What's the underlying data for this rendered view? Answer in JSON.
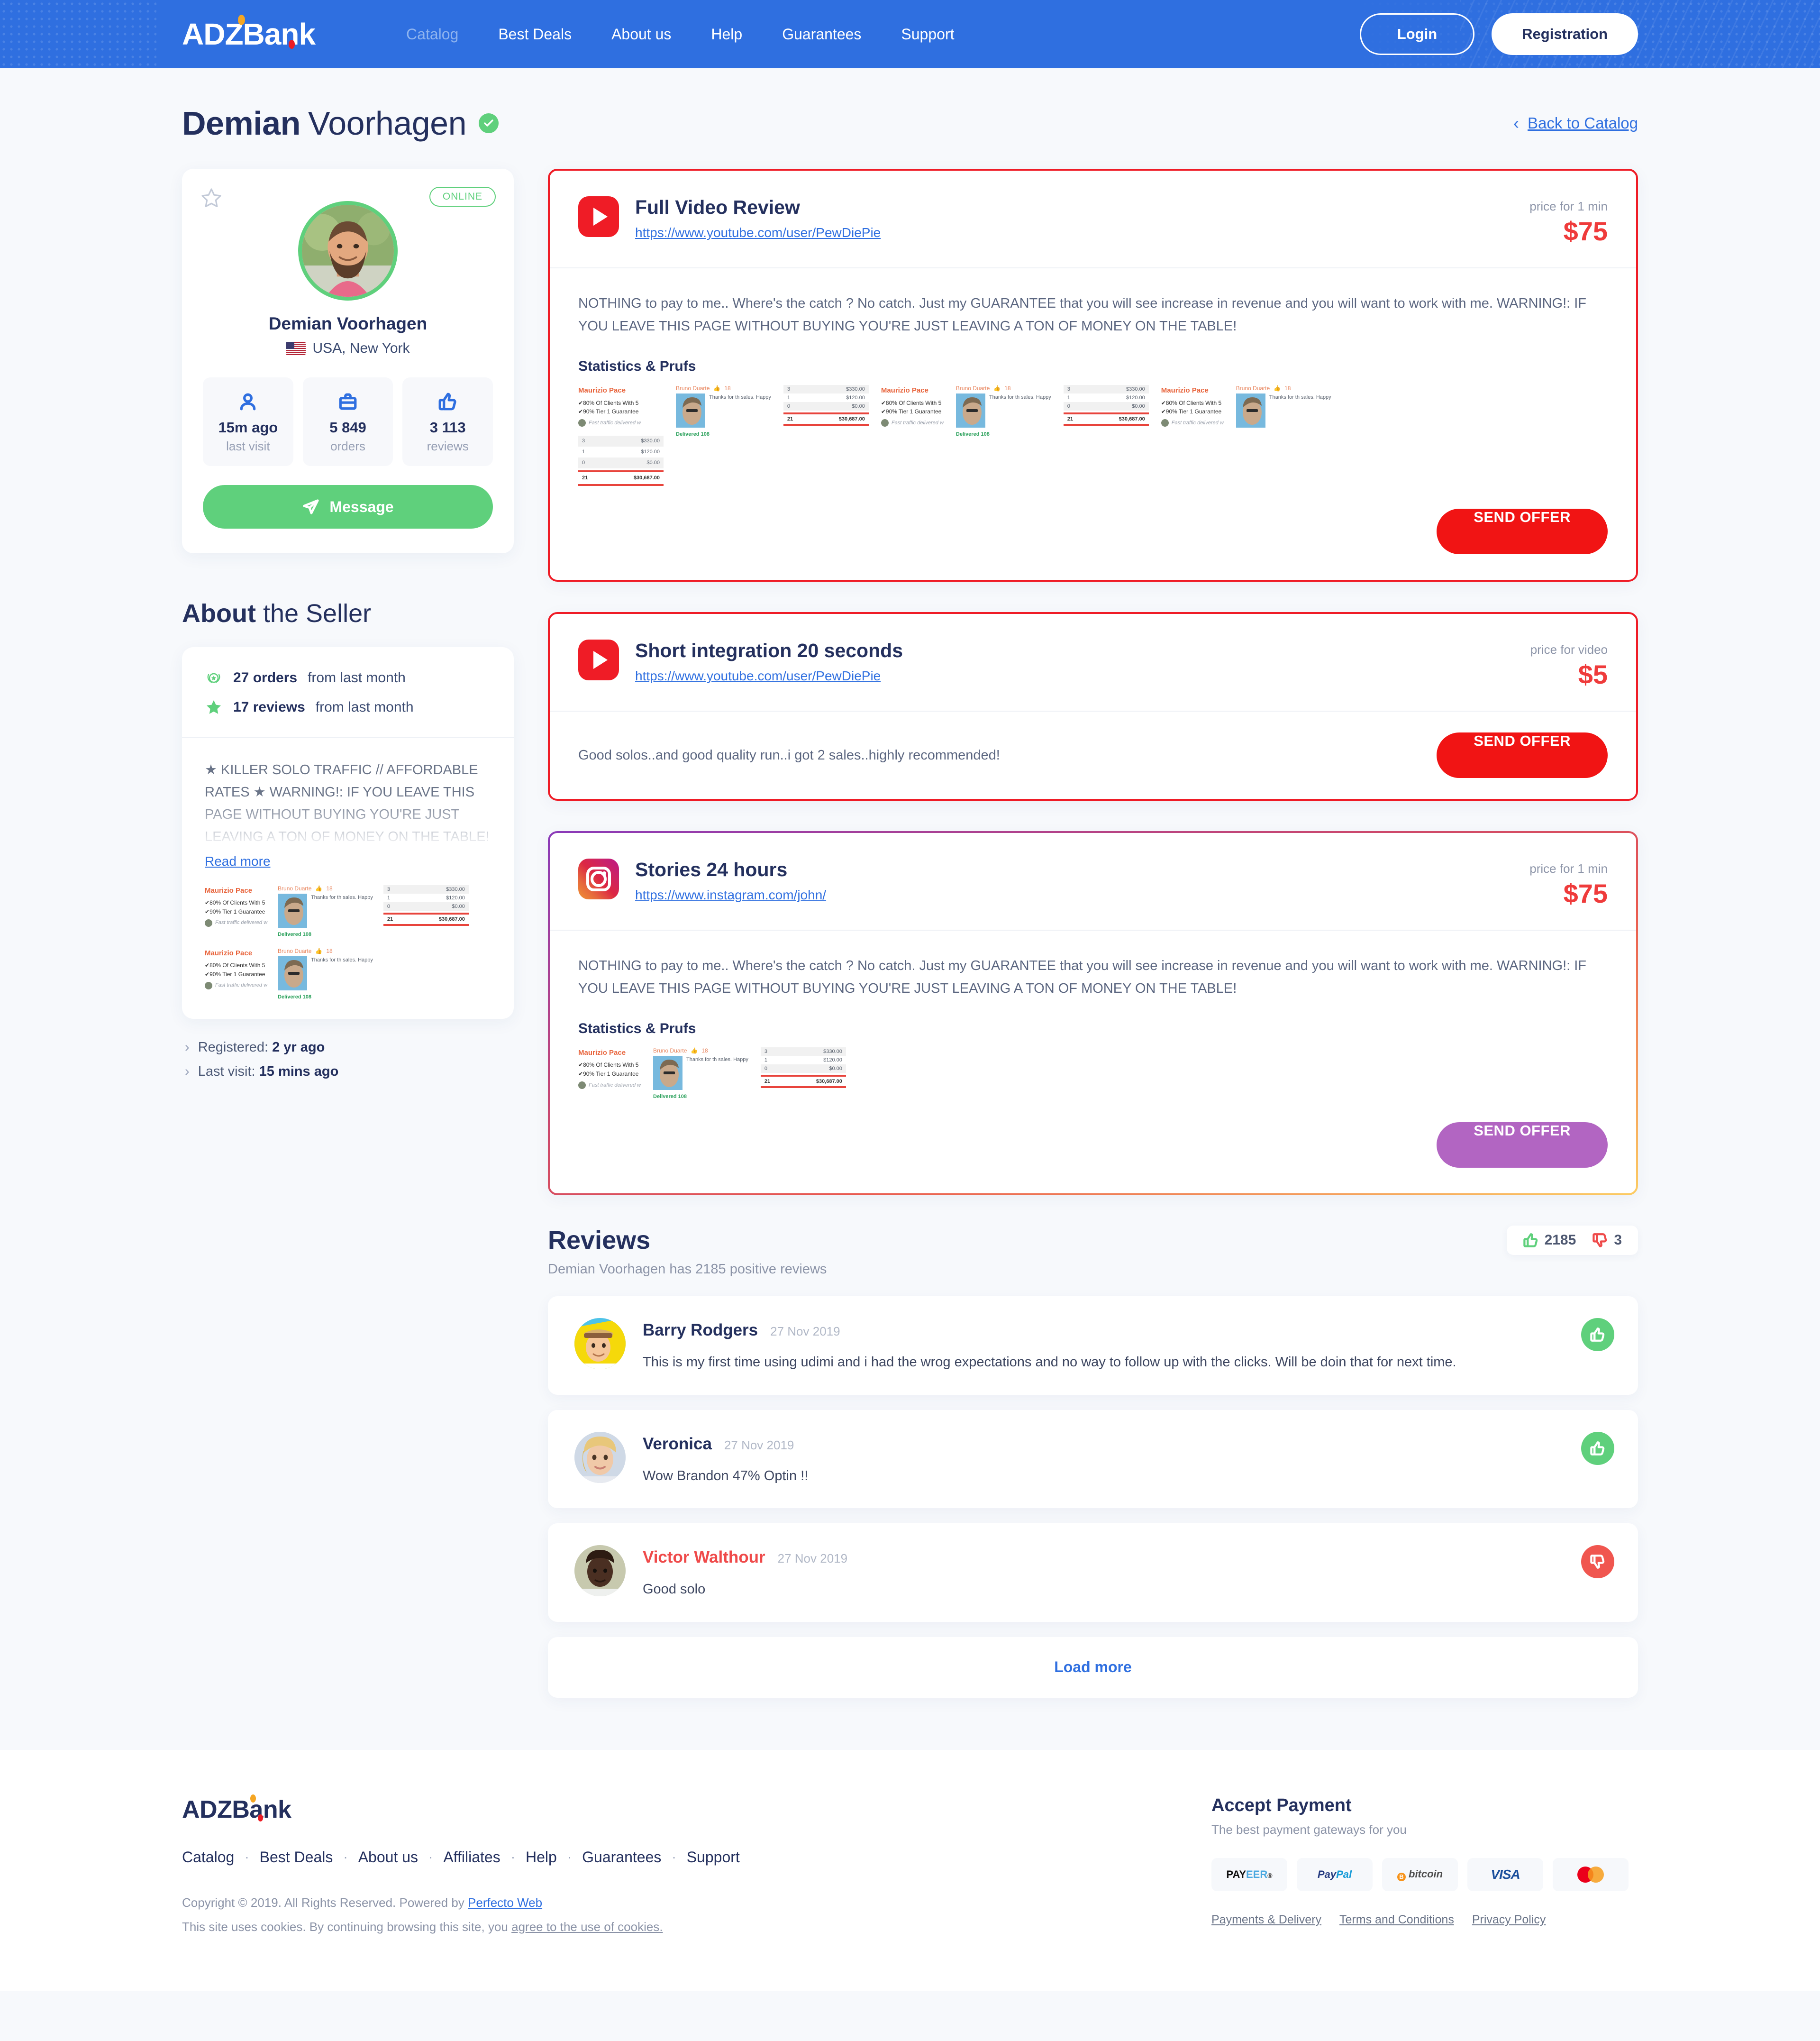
{
  "header": {
    "logo": "ADZBank",
    "nav": [
      {
        "label": "Catalog",
        "active": true
      },
      {
        "label": "Best Deals",
        "active": false
      },
      {
        "label": "About us",
        "active": false
      },
      {
        "label": "Help",
        "active": false
      },
      {
        "label": "Guarantees",
        "active": false
      },
      {
        "label": "Support",
        "active": false
      }
    ],
    "login_label": "Login",
    "registration_label": "Registration"
  },
  "page": {
    "title_bold": "Demian",
    "title_light": "Voorhagen",
    "back_link": "Back to Catalog"
  },
  "profile": {
    "status": "ONLINE",
    "name": "Demian Voorhagen",
    "location": "USA, New York",
    "stats": [
      {
        "icon": "user-icon",
        "value": "15m ago",
        "label": "last visit"
      },
      {
        "icon": "briefcase-icon",
        "value": "5 849",
        "label": "orders"
      },
      {
        "icon": "thumbs-up-icon",
        "value": "3 113",
        "label": "reviews"
      }
    ],
    "message_label": "Message"
  },
  "about": {
    "heading_bold": "About",
    "heading_light": "the Seller",
    "facts": [
      {
        "icon": "laurel-icon",
        "bold": "27 orders",
        "rest": "from last month"
      },
      {
        "icon": "star-icon",
        "bold": "17 reviews",
        "rest": "from last month"
      }
    ],
    "text": "★ KILLER SOLO TRAFFIC // AFFORDABLE RATES ★ WARNING!: IF YOU LEAVE THIS PAGE WITHOUT BUYING YOU'RE JUST LEAVING A TON OF MONEY ON THE TABLE!",
    "read_more": "Read more",
    "meta": [
      {
        "label": "Registered:",
        "value": "2 yr ago"
      },
      {
        "label": "Last visit:",
        "value": "15 mins ago"
      }
    ]
  },
  "proof": {
    "seller_name": "Maurizio Pace",
    "bullet1": "80% Of Clients With 5",
    "bullet2": "90% Tier 1 Guarantee",
    "footnote": "Fast traffic delivered w",
    "buyer_name": "Bruno Duarte",
    "likes": "18",
    "testimonial": "Thanks for th sales. Happy",
    "delivered": "Delivered 108",
    "rows": [
      {
        "qty": "3",
        "amount": "$330.00"
      },
      {
        "qty": "1",
        "amount": "$120.00"
      },
      {
        "qty": "0",
        "amount": "$0.00"
      }
    ],
    "total_qty": "21",
    "total_amount": "$30,687.00"
  },
  "offers": [
    {
      "platform": "youtube",
      "title": "Full Video Review",
      "url": "https://www.youtube.com/user/PewDiePie",
      "price_label": "price for 1 min",
      "price": "$75",
      "description": "NOTHING to pay to me.. Where's the catch ? No catch. Just my GUARANTEE that you will see increase in revenue and you will want to work with me. WARNING!: IF YOU LEAVE THIS PAGE WITHOUT BUYING YOU'RE JUST LEAVING A TON OF MONEY ON THE TABLE!",
      "stats_title": "Statistics & Prufs",
      "send_label": "SEND OFFER",
      "layout": "full"
    },
    {
      "platform": "youtube",
      "title": "Short integration 20 seconds",
      "url": "https://www.youtube.com/user/PewDiePie",
      "price_label": "price for video",
      "price": "$5",
      "description": "Good solos..and good quality run..i got 2 sales..highly recommended!",
      "stats_title": "",
      "send_label": "SEND OFFER",
      "layout": "short"
    },
    {
      "platform": "instagram",
      "title": "Stories 24 hours",
      "url": "https://www.instagram.com/john/",
      "price_label": "price for 1 min",
      "price": "$75",
      "description": "NOTHING to pay to me.. Where's the catch ? No catch. Just my GUARANTEE that you will see increase in revenue and you will want to work with me. WARNING!: IF YOU LEAVE THIS PAGE WITHOUT BUYING YOU'RE JUST LEAVING A TON OF MONEY ON THE TABLE!",
      "stats_title": "Statistics & Prufs",
      "send_label": "SEND OFFER",
      "layout": "full"
    }
  ],
  "reviews": {
    "title": "Reviews",
    "subtitle": "Demian Voorhagen has 2185 positive reviews",
    "positive_count": "2185",
    "negative_count": "3",
    "items": [
      {
        "name": "Barry Rodgers",
        "date": "27 Nov 2019",
        "text": "This is my first time using udimi and i had the wrog expectations and no way to follow up with the clicks. Will be doin that for next time.",
        "sentiment": "positive"
      },
      {
        "name": "Veronica",
        "date": "27 Nov 2019",
        "text": "Wow Brandon 47% Optin !!",
        "sentiment": "positive"
      },
      {
        "name": "Victor Walthour",
        "date": "27 Nov 2019",
        "text": "Good solo",
        "sentiment": "negative"
      }
    ],
    "load_more": "Load more"
  },
  "footer": {
    "logo": "ADZBank",
    "nav": [
      "Catalog",
      "Best Deals",
      "About us",
      "Affiliates",
      "Help",
      "Guarantees",
      "Support"
    ],
    "copyright_text": "Copyright © 2019. All Rights Reserved. Powered by ",
    "copyright_link": "Perfecto Web",
    "cookie_text": "This site uses cookies. By continuing browsing this site, you ",
    "cookie_link": "agree to the use of cookies.",
    "payment_heading": "Accept Payment",
    "payment_sub": "The best payment gateways for you",
    "payment_methods": [
      "PAYEER",
      "PayPal",
      "bitcoin",
      "VISA",
      "mastercard"
    ],
    "legal_links": [
      "Payments & Delivery",
      "Terms and Conditions",
      "Privacy Policy"
    ]
  },
  "colors": {
    "brand_blue": "#2f6fe0",
    "navy": "#24305e",
    "green": "#5fd07c",
    "red": "#ef1c26",
    "price_red": "#ef3b3b",
    "purple": "#b265c2"
  }
}
